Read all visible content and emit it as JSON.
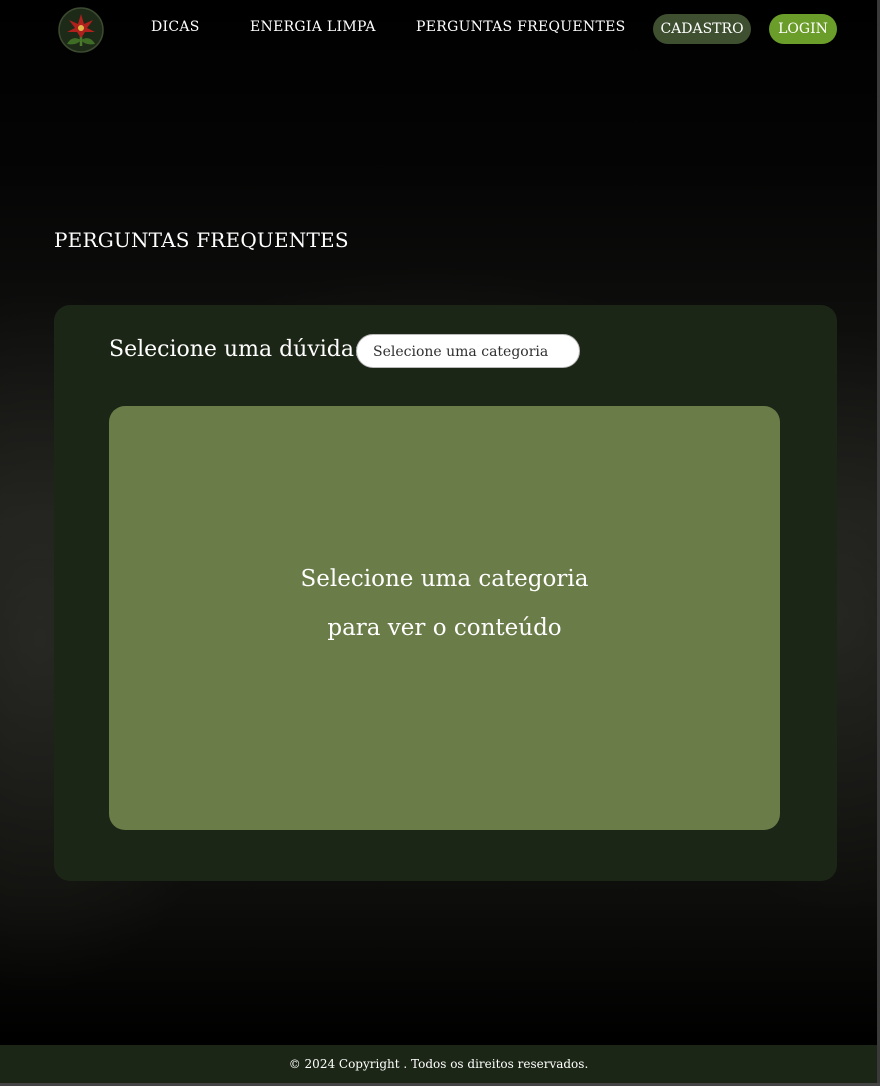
{
  "header": {
    "logo_icon": "flower-logo-icon",
    "nav": {
      "dicas": "DICAS",
      "energia_limpa": "ENERGIA LIMPA",
      "perguntas_frequentes": "PERGUNTAS FREQUENTES"
    },
    "cadastro_label": "CADASTRO",
    "login_label": "LOGIN"
  },
  "main": {
    "title": "PERGUNTAS FREQUENTES",
    "select_label": "Selecione uma dúvida:",
    "select_value": "Selecione uma categoria",
    "content_line_1": "Selecione uma categoria",
    "content_line_2": "para ver o conteúdo"
  },
  "footer": {
    "copyright": "© 2024 Copyright . Todos os direitos reservados."
  },
  "colors": {
    "background": "#000000",
    "panel": "#1c2616",
    "content_box": "#6a7c48",
    "cadastro_button": "#3f5030",
    "login_button": "#6b9d2b"
  }
}
